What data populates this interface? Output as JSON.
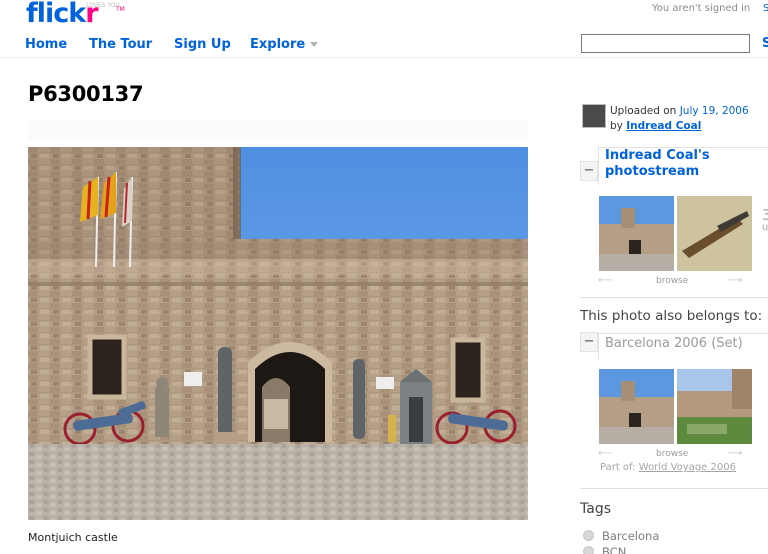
{
  "header": {
    "logo_main": "flick",
    "logo_r": "r",
    "logo_tagline": "LOVES YOU",
    "logo_tm": "TM",
    "signed_in_text": "You aren't signed in",
    "signed_in_link": "S",
    "search_button": "S"
  },
  "nav": {
    "home": "Home",
    "tour": "The Tour",
    "signup": "Sign Up",
    "explore": "Explore"
  },
  "photo": {
    "title": "P6300137",
    "caption": "Montjuich castle"
  },
  "sidebar": {
    "uploaded_prefix": "Uploaded on",
    "uploaded_date": "July 19, 2006",
    "by_prefix": "by",
    "owner": "Indread Coal",
    "photostream_title": "Indread Coal's photostream",
    "browse_label": "browse",
    "count_partial": "3",
    "count_unit_partial": "u",
    "belongs_heading": "This photo also belongs to:",
    "set_title": "Barcelona 2006 (Set)",
    "part_of_prefix": "Part of:",
    "part_of_link": "World Voyage 2006",
    "collapse_symbol": "−"
  },
  "tags": {
    "heading": "Tags",
    "items": [
      "Barcelona",
      "BCN"
    ]
  },
  "colors": {
    "brand_blue": "#0063dc",
    "brand_pink": "#ff0084"
  }
}
